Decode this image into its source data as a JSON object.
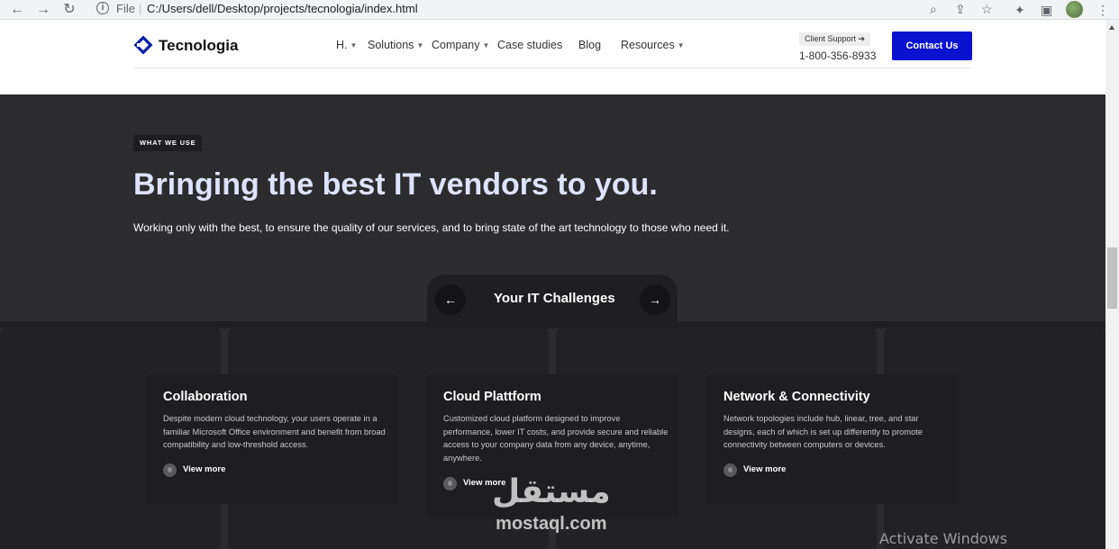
{
  "browser": {
    "back_icon": "arrow-left-icon",
    "forward_icon": "arrow-right-icon",
    "reload_icon": "reload-icon",
    "info_icon": "info-icon",
    "scheme_label": "File",
    "url": "C:/Users/dell/Desktop/projects/tecnologia/index.html",
    "address_actions": [
      "zoom-icon",
      "share-icon",
      "star-icon"
    ],
    "toolbar_actions": [
      "extensions-icon",
      "side-panel-icon",
      "profile-avatar",
      "more-menu-icon"
    ]
  },
  "header": {
    "brand": "Tecnologia",
    "nav": [
      {
        "label": "H.",
        "has_dropdown": true
      },
      {
        "label": "Solutions",
        "has_dropdown": true
      },
      {
        "label": "Company",
        "has_dropdown": true
      },
      {
        "label": "Case studies",
        "has_dropdown": false
      },
      {
        "label": "Blog",
        "has_dropdown": false
      },
      {
        "label": "Resources",
        "has_dropdown": true
      }
    ],
    "support_label": "Client Support ➔",
    "phone": "1-800-356-8933",
    "cta_label": "Contact Us",
    "accent_color": "#0a12cf"
  },
  "hero": {
    "eyebrow": "WHAT WE USE",
    "headline": "Bringing the best IT vendors to you.",
    "subtext": "Working only with the best, to ensure the quality of our services, and to bring state of the art technology to those who need it.",
    "headline_color": "#dde3ff",
    "background_color": "#2c2c2e"
  },
  "challenges": {
    "title": "Your IT Challenges",
    "prev_label": "←",
    "next_label": "→",
    "cards": [
      {
        "title": "Collaboration",
        "description": "Despite modern cloud technology, your users operate in a familiar Microsoft Office environment and benefit from broad compatibility and low-threshold access.",
        "link": "View more"
      },
      {
        "title": "Cloud Plattform",
        "description": "Customized cloud platform designed to improve performance, lower IT costs, and provide secure and reliable access to your company data from any device, anytime, anywhere.",
        "link": "View more"
      },
      {
        "title": "Network & Connectivity",
        "description": "Network topologies include hub, linear, tree, and star designs, each of which is set up differently to promote connectivity between computers or devices.",
        "link": "View more"
      }
    ]
  },
  "overlay": {
    "watermark_arabic": "مستقل",
    "watermark_latin": "mostaql.com",
    "os_notice": "Activate Windows"
  }
}
